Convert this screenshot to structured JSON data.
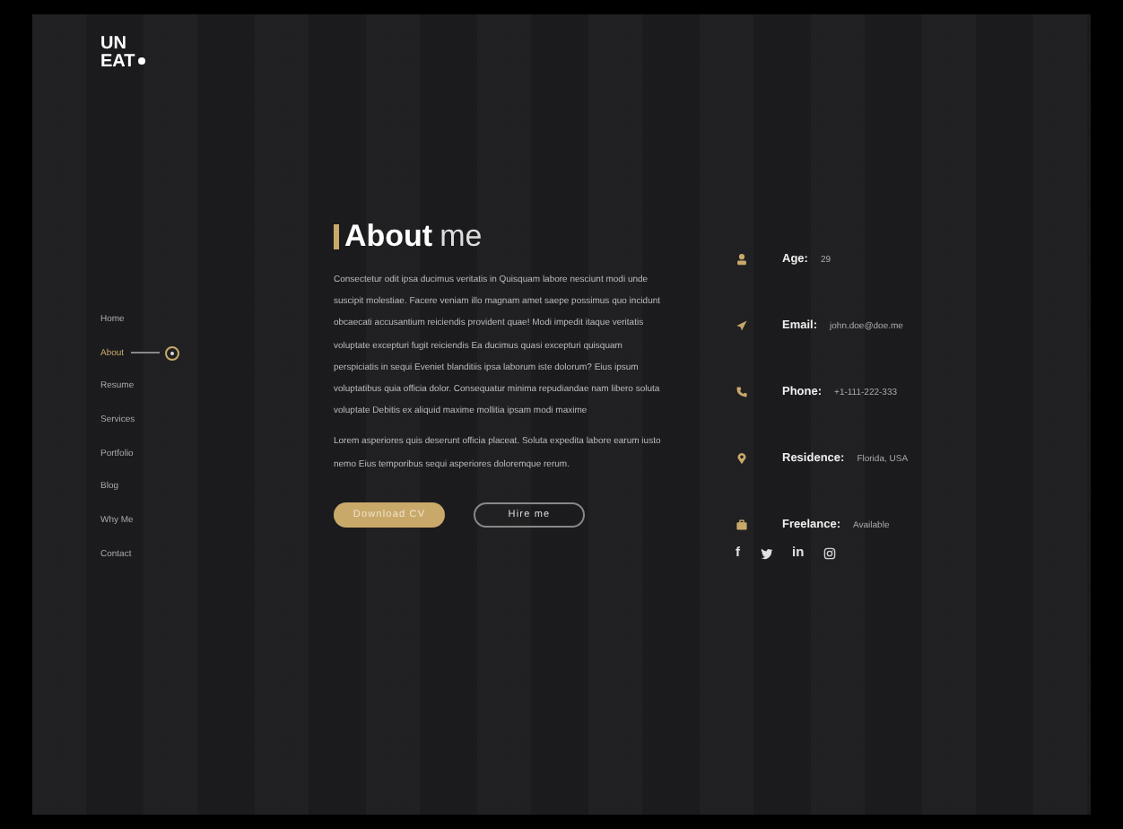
{
  "logo": {
    "line1": "UN",
    "line2": "EAT"
  },
  "nav": [
    {
      "label": "Home",
      "selected": false
    },
    {
      "label": "About",
      "selected": true
    },
    {
      "label": "Resume",
      "selected": false
    },
    {
      "label": "Services",
      "selected": false
    },
    {
      "label": "Portfolio",
      "selected": false
    },
    {
      "label": "Blog",
      "selected": false
    },
    {
      "label": "Why Me",
      "selected": false
    },
    {
      "label": "Contact",
      "selected": false
    }
  ],
  "heading": {
    "bold": "About",
    "light": "me"
  },
  "paragraphs": [
    "Consectetur odit ipsa ducimus veritatis in Quisquam labore nesciunt modi unde suscipit molestiae. Facere veniam illo magnam amet saepe possimus quo incidunt obcaecati accusantium reiciendis provident quae! Modi impedit itaque veritatis voluptate excepturi fugit reiciendis Ea ducimus quasi excepturi quisquam perspiciatis in sequi Eveniet blanditiis ipsa laborum iste dolorum? Eius ipsum voluptatibus quia officia dolor. Consequatur minima repudiandae nam libero soluta voluptate Debitis ex aliquid maxime mollitia ipsam modi maxime",
    "Lorem asperiores quis deserunt officia placeat. Soluta expedita labore earum iusto nemo Eius temporibus sequi asperiores doloremque rerum."
  ],
  "buttons": [
    {
      "label": "Download CV",
      "kind": "primary"
    },
    {
      "label": "Hire me",
      "kind": "outline"
    }
  ],
  "info": [
    {
      "kind": "person",
      "label": "Age:",
      "value": "29"
    },
    {
      "kind": "plane",
      "label": "Email:",
      "value": "john.doe@doe.me"
    },
    {
      "kind": "phone",
      "label": "Phone:",
      "value": "+1-111-222-333"
    },
    {
      "kind": "pin",
      "label": "Residence:",
      "value": "Florida, USA"
    },
    {
      "kind": "briefcase",
      "label": "Freelance:",
      "value": "Available"
    }
  ],
  "social": [
    {
      "kind": "text",
      "label": "f"
    },
    {
      "kind": "bird"
    },
    {
      "kind": "text",
      "label": "in"
    },
    {
      "kind": "camera"
    }
  ]
}
